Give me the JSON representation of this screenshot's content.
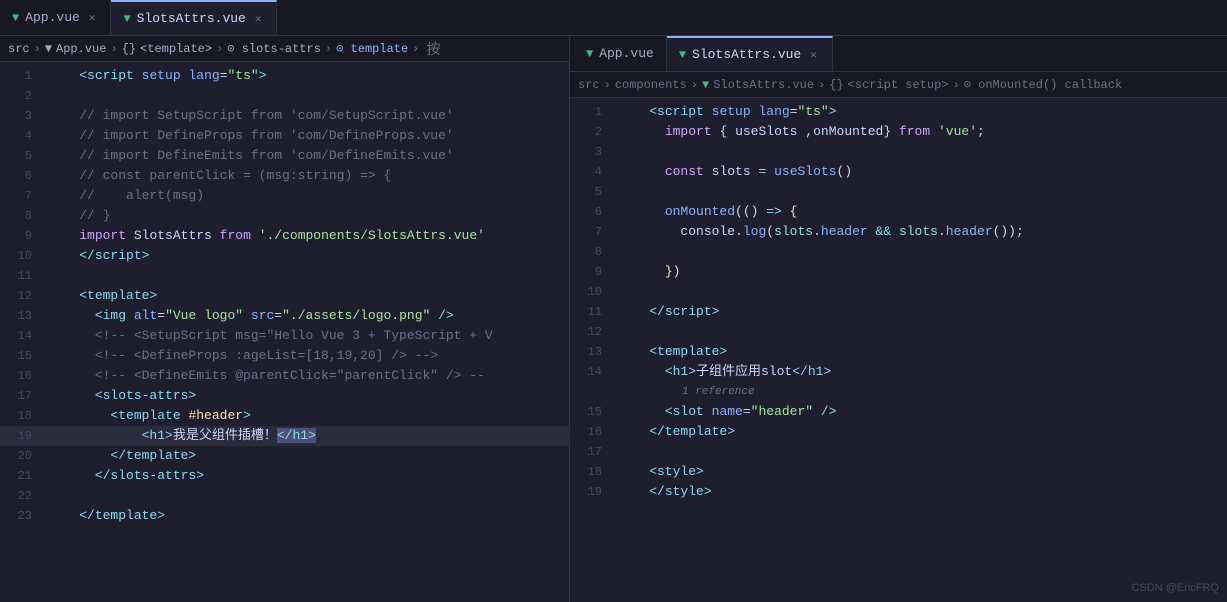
{
  "left_tabs": [
    {
      "label": "App.vue",
      "active": false,
      "closeable": true
    },
    {
      "label": "SlotsAttrs.vue",
      "active": true,
      "closeable": true
    }
  ],
  "right_tabs": [
    {
      "label": "App.vue",
      "active": false,
      "closeable": false
    },
    {
      "label": "SlotsAttrs.vue",
      "active": true,
      "closeable": true
    }
  ],
  "left_breadcrumb": "src > App.vue > {} <template> > slots-attrs > template > 按",
  "right_breadcrumb": "src > components > SlotsAttrs.vue > {} <script setup> > onMounted() callback",
  "watermark": "CSDN @EricFRQ",
  "toolbar": {
    "split_label": "按"
  }
}
